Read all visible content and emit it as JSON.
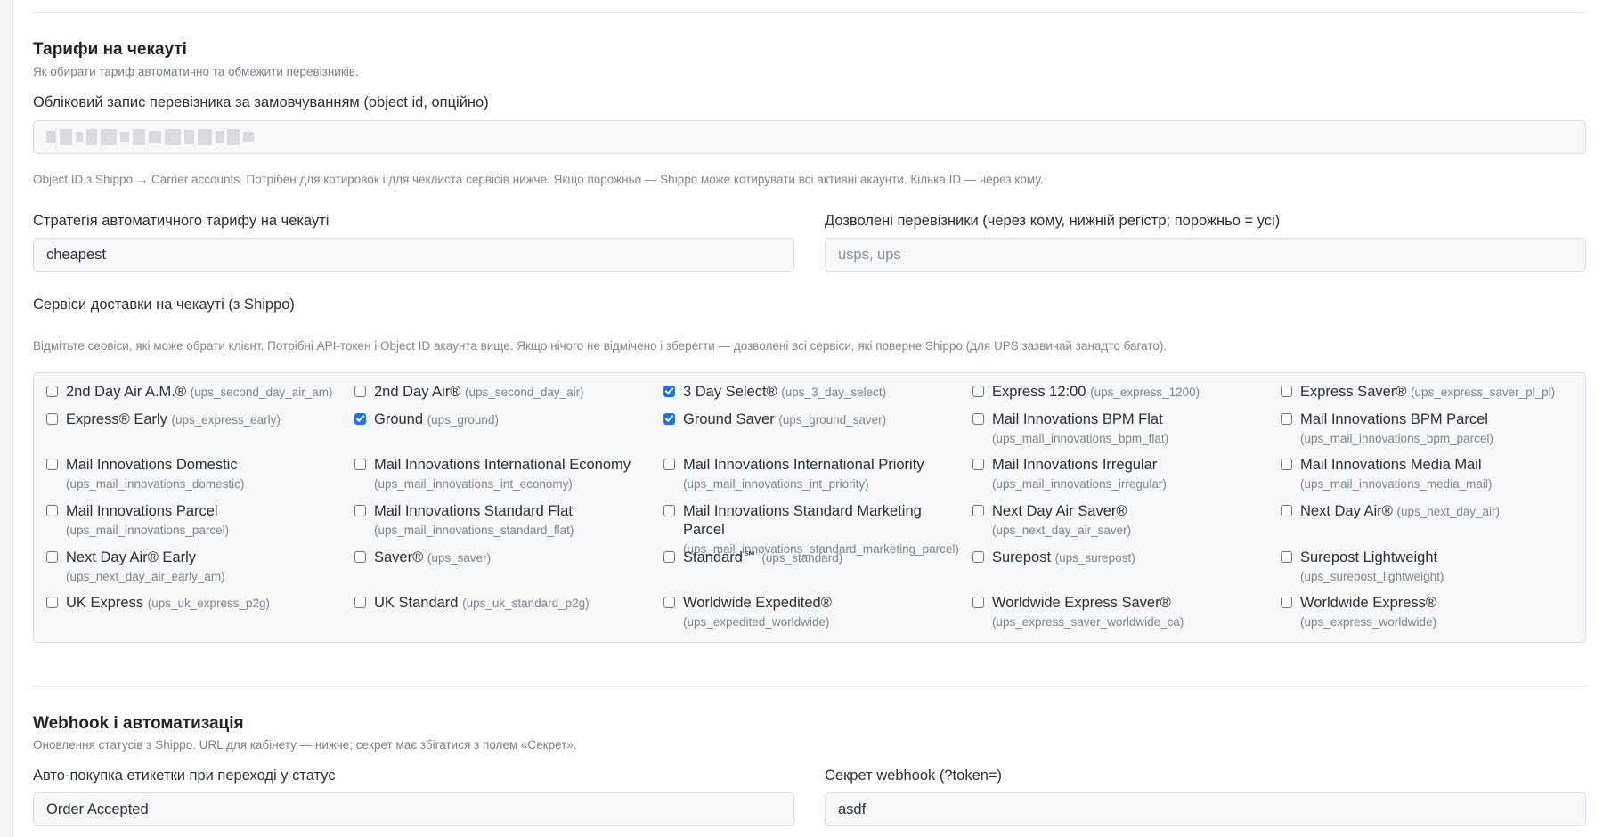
{
  "checkout_rates": {
    "title": "Тарифи на чекауті",
    "description": "Як обирати тариф автоматично та обмежити перевізників.",
    "default_account_label": "Обліковий запис перевізника за замовчуванням (object id, опційно)",
    "default_account_help": "Object ID з Shippo → Carrier accounts. Потрібен для котировок і для чеклиста сервісів нижче. Якщо порожньо — Shippo може котирувати всі активні акаунти. Кілька ID — через кому.",
    "strategy_label": "Стратегія автоматичного тарифу на чекауті",
    "strategy_value": "cheapest",
    "carriers_label": "Дозволені перевізники (через кому, нижній регістр; порожньо = усі)",
    "carriers_placeholder": "usps, ups",
    "services_label": "Сервіси доставки на чекауті (з Shippo)",
    "services_help": "Відмітьте сервіси, які може обрати клієнт. Потрібні API-токен і Object ID акаунта вище. Якщо нічого не відмічено і зберегти — дозволені всі сервіси, які поверне Shippo (для UPS зазвичай занадто багато).",
    "services": [
      {
        "name": "2nd Day Air A.M.®",
        "code": "(ups_second_day_air_am)",
        "checked": false
      },
      {
        "name": "2nd Day Air®",
        "code": "(ups_second_day_air)",
        "checked": false
      },
      {
        "name": "3 Day Select®",
        "code": "(ups_3_day_select)",
        "checked": true
      },
      {
        "name": "Express 12:00",
        "code": "(ups_express_1200)",
        "checked": false
      },
      {
        "name": "Express Saver®",
        "code": "(ups_express_saver_pl_pl)",
        "checked": false
      },
      {
        "name": "Express® Early",
        "code": "(ups_express_early)",
        "checked": false
      },
      {
        "name": "Ground",
        "code": "(ups_ground)",
        "checked": true
      },
      {
        "name": "Ground Saver",
        "code": "(ups_ground_saver)",
        "checked": true
      },
      {
        "name": "Mail Innovations BPM Flat",
        "code": "(ups_mail_innovations_bpm_flat)",
        "checked": false
      },
      {
        "name": "Mail Innovations BPM Parcel",
        "code": "(ups_mail_innovations_bpm_parcel)",
        "checked": false
      },
      {
        "name": "Mail Innovations Domestic",
        "code": "(ups_mail_innovations_domestic)",
        "checked": false
      },
      {
        "name": "Mail Innovations International Economy",
        "code": "(ups_mail_innovations_int_economy)",
        "checked": false
      },
      {
        "name": "Mail Innovations International Priority",
        "code": "(ups_mail_innovations_int_priority)",
        "checked": false
      },
      {
        "name": "Mail Innovations Irregular",
        "code": "(ups_mail_innovations_irregular)",
        "checked": false
      },
      {
        "name": "Mail Innovations Media Mail",
        "code": "(ups_mail_innovations_media_mail)",
        "checked": false
      },
      {
        "name": "Mail Innovations Parcel",
        "code": "(ups_mail_innovations_parcel)",
        "checked": false
      },
      {
        "name": "Mail Innovations Standard Flat",
        "code": "(ups_mail_innovations_standard_flat)",
        "checked": false
      },
      {
        "name": "Mail Innovations Standard Marketing Parcel",
        "code": "(ups_mail_innovations_standard_marketing_parcel)",
        "checked": false
      },
      {
        "name": "Next Day Air Saver®",
        "code": "(ups_next_day_air_saver)",
        "checked": false
      },
      {
        "name": "Next Day Air®",
        "code": "(ups_next_day_air)",
        "checked": false
      },
      {
        "name": "Next Day Air® Early",
        "code": "(ups_next_day_air_early_am)",
        "checked": false
      },
      {
        "name": "Saver®",
        "code": "(ups_saver)",
        "checked": false
      },
      {
        "name": "Standard℠",
        "code": "(ups_standard)",
        "checked": false
      },
      {
        "name": "Surepost",
        "code": "(ups_surepost)",
        "checked": false
      },
      {
        "name": "Surepost Lightweight",
        "code": "(ups_surepost_lightweight)",
        "checked": false
      },
      {
        "name": "UK Express",
        "code": "(ups_uk_express_p2g)",
        "checked": false
      },
      {
        "name": "UK Standard",
        "code": "(ups_uk_standard_p2g)",
        "checked": false
      },
      {
        "name": "Worldwide Expedited®",
        "code": "(ups_expedited_worldwide)",
        "checked": false
      },
      {
        "name": "Worldwide Express Saver®",
        "code": "(ups_express_saver_worldwide_ca)",
        "checked": false
      },
      {
        "name": "Worldwide Express®",
        "code": "(ups_express_worldwide)",
        "checked": false
      }
    ]
  },
  "webhook": {
    "title": "Webhook і автоматизація",
    "description": "Оновлення статусів з Shippo. URL для кабінету — нижче; секрет має збігатися з полем «Секрет».",
    "autobuy_label": "Авто-покупка етикетки при переході у статус",
    "autobuy_value": "Order Accepted",
    "secret_label": "Секрет webhook (?token=)",
    "secret_value": "asdf"
  },
  "colors": {
    "accent": "#1a73e8",
    "field_bg": "#f6f7f8",
    "border": "#dadde1"
  }
}
